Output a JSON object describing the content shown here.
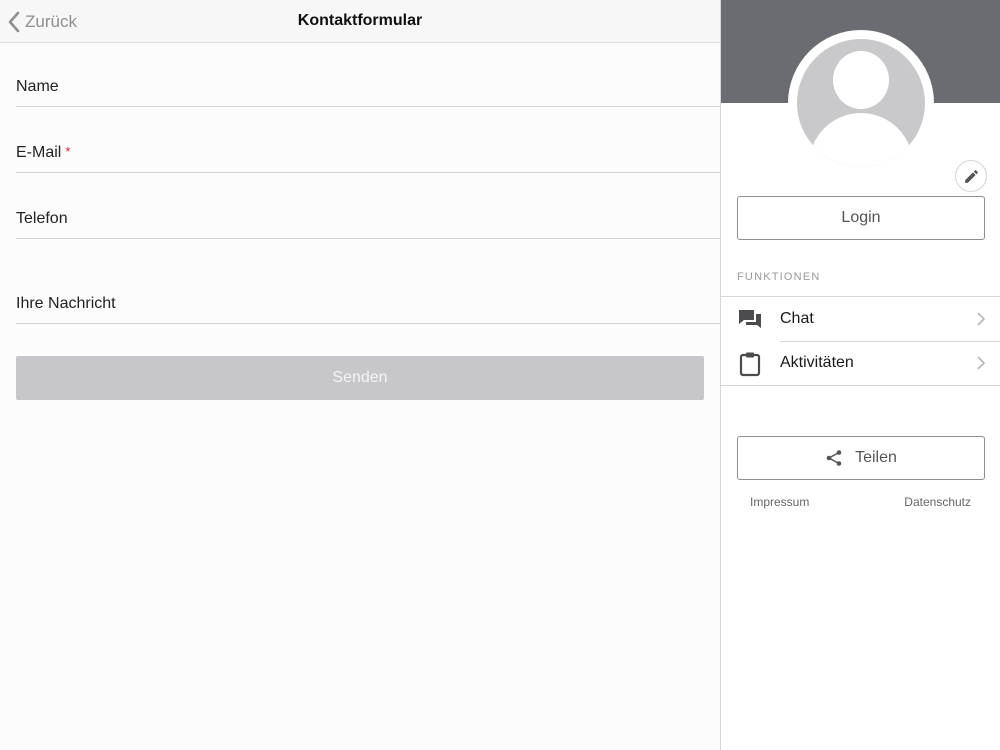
{
  "navbar": {
    "back_label": "Zurück",
    "title": "Kontaktformular"
  },
  "form": {
    "fields": [
      {
        "label": "Name",
        "required": false
      },
      {
        "label": "E-Mail",
        "required": true
      },
      {
        "label": "Telefon",
        "required": false
      },
      {
        "label": "Ihre Nachricht",
        "required": false
      }
    ],
    "required_marker": "*",
    "submit_label": "Senden"
  },
  "sidebar": {
    "login_label": "Login",
    "section_label": "FUNKTIONEN",
    "items": [
      {
        "label": "Chat",
        "icon": "chat-icon"
      },
      {
        "label": "Aktivitäten",
        "icon": "clipboard-icon"
      }
    ],
    "share_label": "Teilen",
    "footer": {
      "impressum": "Impressum",
      "datenschutz": "Datenschutz"
    }
  },
  "colors": {
    "cover": "#6b6b72",
    "required": "#d9262e",
    "button_disabled": "#c7c6cb",
    "border": "#8e8e93"
  }
}
